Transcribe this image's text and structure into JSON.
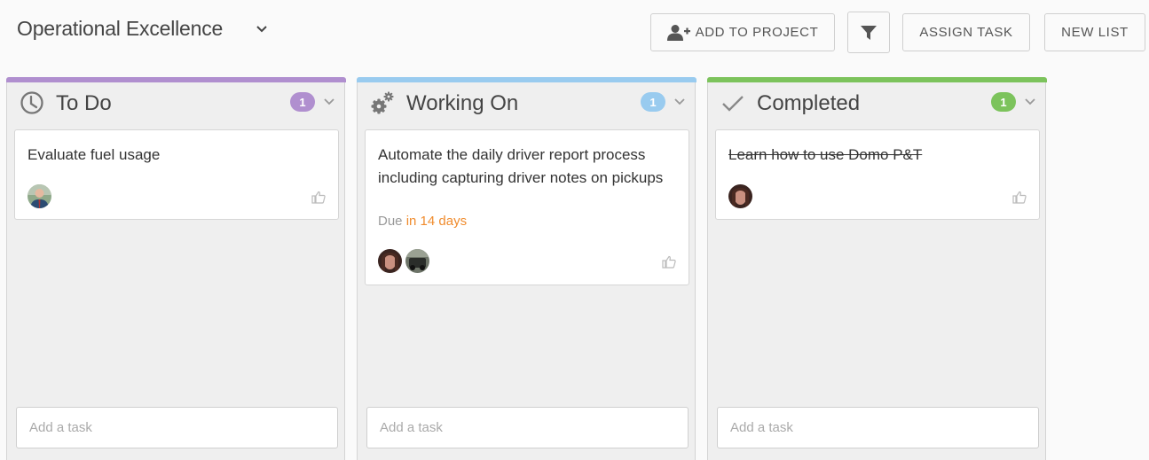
{
  "header": {
    "project_title": "Operational Excellence",
    "buttons": {
      "add_to_project": "ADD TO PROJECT",
      "assign_task": "ASSIGN TASK",
      "new_list": "NEW LIST"
    }
  },
  "columns": [
    {
      "title": "To Do",
      "icon": "clock-icon",
      "count": "1",
      "color": "#b08fcf",
      "cards": [
        {
          "title": "Evaluate fuel usage",
          "completed": false,
          "assignees": [
            "man-in-suit-avatar"
          ]
        }
      ],
      "add_task_placeholder": "Add a task"
    },
    {
      "title": "Working On",
      "icon": "gears-icon",
      "count": "1",
      "color": "#99cbef",
      "cards": [
        {
          "title": "Automate the daily driver report process including capturing driver notes on pickups",
          "completed": false,
          "due_label": "Due",
          "due_value": "in 14 days",
          "assignees": [
            "woman-avatar",
            "vehicle-avatar"
          ]
        }
      ],
      "add_task_placeholder": "Add a task"
    },
    {
      "title": "Completed",
      "icon": "check-icon",
      "count": "1",
      "color": "#7cc35c",
      "cards": [
        {
          "title": "Learn how to use Domo P&T",
          "completed": true,
          "assignees": [
            "woman-avatar"
          ]
        }
      ],
      "add_task_placeholder": "Add a task"
    }
  ]
}
